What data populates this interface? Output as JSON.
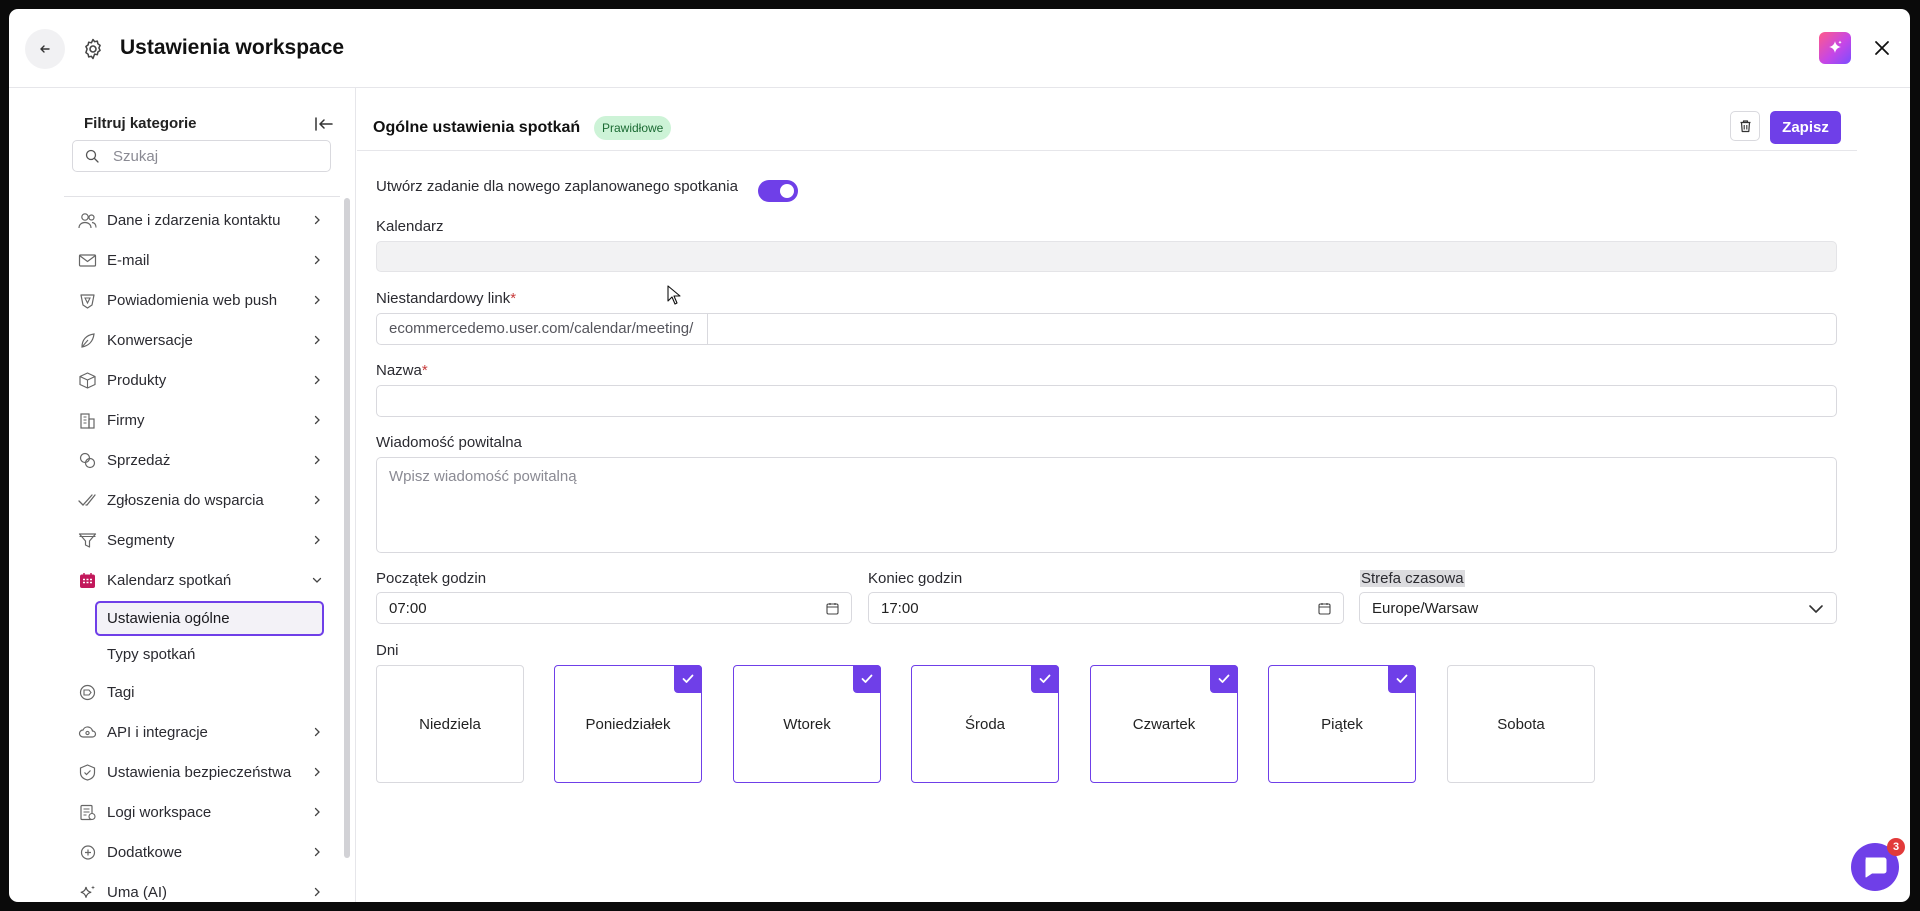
{
  "header": {
    "title": "Ustawienia workspace",
    "back_icon": "arrow-left-icon",
    "settings_icon": "gear-icon",
    "ai_icon": "sparkle-icon",
    "close_icon": "close-icon"
  },
  "sidebar": {
    "filter_label": "Filtruj kategorie",
    "search_placeholder": "Szukaj",
    "items": [
      {
        "label": "Dane i zdarzenia kontaktu",
        "icon": "users-icon"
      },
      {
        "label": "E-mail",
        "icon": "envelope-icon"
      },
      {
        "label": "Powiadomienia web push",
        "icon": "shield-bell-icon"
      },
      {
        "label": "Konwersacje",
        "icon": "chat-leaf-icon"
      },
      {
        "label": "Produkty",
        "icon": "box-icon"
      },
      {
        "label": "Firmy",
        "icon": "building-icon"
      },
      {
        "label": "Sprzedaż",
        "icon": "coins-icon"
      },
      {
        "label": "Zgłoszenia do wsparcia",
        "icon": "check-double-icon"
      },
      {
        "label": "Segmenty",
        "icon": "filter-icon"
      },
      {
        "label": "Kalendarz spotkań",
        "icon": "calendar-icon"
      }
    ],
    "sub_items": [
      {
        "label": "Ustawienia ogólne"
      },
      {
        "label": "Typy spotkań"
      }
    ],
    "items_after": [
      {
        "label": "Tagi",
        "icon": "tag-icon"
      },
      {
        "label": "API i integracje",
        "icon": "cloud-icon"
      },
      {
        "label": "Ustawienia bezpieczeństwa",
        "icon": "shield-icon"
      },
      {
        "label": "Logi workspace",
        "icon": "log-icon"
      },
      {
        "label": "Dodatkowe",
        "icon": "plus-circle-icon"
      },
      {
        "label": "Uma (AI)",
        "icon": "sparkle-icon"
      }
    ]
  },
  "main": {
    "title": "Ogólne ustawienia spotkań",
    "status_badge": "Prawidłowe",
    "save_label": "Zapisz",
    "toggle_label": "Utwórz zadanie dla nowego zaplanowanego spotkania",
    "calendar_label": "Kalendarz",
    "link_label": "Niestandardowy link",
    "link_prefix": "ecommercedemo.user.com/calendar/meeting/",
    "name_label": "Nazwa",
    "welcome_label": "Wiadomość powitalna",
    "welcome_placeholder": "Wpisz wiadomość powitalną",
    "start_label": "Początek godzin",
    "start_value": "07:00",
    "end_label": "Koniec godzin",
    "end_value": "17:00",
    "timezone_label": "Strefa czasowa",
    "timezone_value": "Europe/Warsaw",
    "days_label": "Dni",
    "days": [
      {
        "label": "Niedziela",
        "checked": false
      },
      {
        "label": "Poniedziałek",
        "checked": true
      },
      {
        "label": "Wtorek",
        "checked": true
      },
      {
        "label": "Środa",
        "checked": true
      },
      {
        "label": "Czwartek",
        "checked": true
      },
      {
        "label": "Piątek",
        "checked": true
      },
      {
        "label": "Sobota",
        "checked": false
      }
    ]
  },
  "chat": {
    "badge_count": "3"
  },
  "colors": {
    "accent": "#6f3fe8",
    "badge_bg": "#cdf3d7",
    "notification": "#e23a3a"
  }
}
